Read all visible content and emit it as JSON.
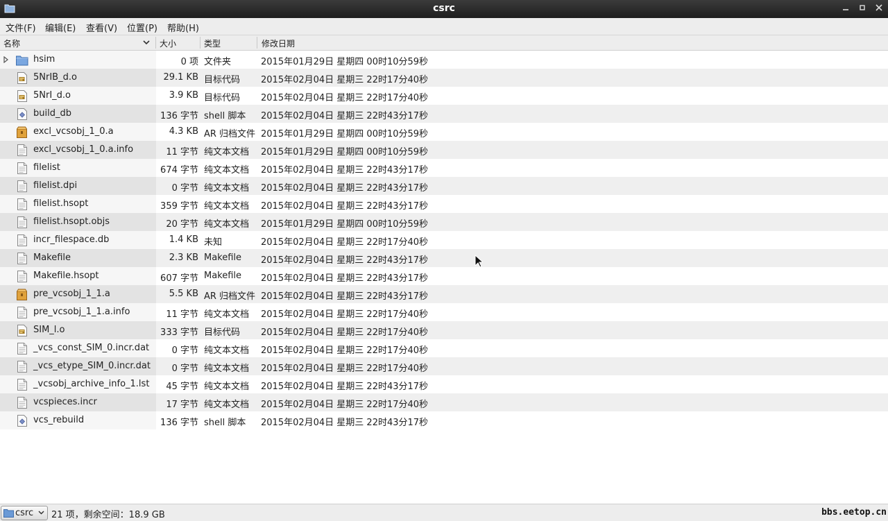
{
  "window": {
    "title": "csrc"
  },
  "menu": [
    "文件(F)",
    "编辑(E)",
    "查看(V)",
    "位置(P)",
    "帮助(H)"
  ],
  "columns": {
    "name": "名称",
    "size": "大小",
    "type": "类型",
    "date": "修改日期"
  },
  "files": [
    {
      "name": "hsim",
      "size": "0 项",
      "type": "文件夹",
      "date": "2015年01月29日 星期四 00时10分59秒",
      "icon": "folder-icon",
      "expandable": true
    },
    {
      "name": "5NrIB_d.o",
      "size": "29.1 KB",
      "type": "目标代码",
      "date": "2015年02月04日 星期三 22时17分40秒",
      "icon": "object-file-icon"
    },
    {
      "name": "5NrI_d.o",
      "size": "3.9 KB",
      "type": "目标代码",
      "date": "2015年02月04日 星期三 22时17分40秒",
      "icon": "object-file-icon"
    },
    {
      "name": "build_db",
      "size": "136 字节",
      "type": "shell 脚本",
      "date": "2015年02月04日 星期三 22时43分17秒",
      "icon": "script-file-icon"
    },
    {
      "name": "excl_vcsobj_1_0.a",
      "size": "4.3 KB",
      "type": "AR 归档文件",
      "date": "2015年01月29日 星期四 00时10分59秒",
      "icon": "archive-file-icon"
    },
    {
      "name": "excl_vcsobj_1_0.a.info",
      "size": "11 字节",
      "type": "纯文本文档",
      "date": "2015年01月29日 星期四 00时10分59秒",
      "icon": "text-file-icon"
    },
    {
      "name": "filelist",
      "size": "674 字节",
      "type": "纯文本文档",
      "date": "2015年02月04日 星期三 22时43分17秒",
      "icon": "text-file-icon"
    },
    {
      "name": "filelist.dpi",
      "size": "0 字节",
      "type": "纯文本文档",
      "date": "2015年02月04日 星期三 22时43分17秒",
      "icon": "text-file-icon"
    },
    {
      "name": "filelist.hsopt",
      "size": "359 字节",
      "type": "纯文本文档",
      "date": "2015年02月04日 星期三 22时43分17秒",
      "icon": "text-file-icon"
    },
    {
      "name": "filelist.hsopt.objs",
      "size": "20 字节",
      "type": "纯文本文档",
      "date": "2015年01月29日 星期四 00时10分59秒",
      "icon": "text-file-icon"
    },
    {
      "name": "incr_filespace.db",
      "size": "1.4 KB",
      "type": "未知",
      "date": "2015年02月04日 星期三 22时17分40秒",
      "icon": "text-file-icon"
    },
    {
      "name": "Makefile",
      "size": "2.3 KB",
      "type": "Makefile",
      "date": "2015年02月04日 星期三 22时43分17秒",
      "icon": "text-file-icon"
    },
    {
      "name": "Makefile.hsopt",
      "size": "607 字节",
      "type": "Makefile",
      "date": "2015年02月04日 星期三 22时43分17秒",
      "icon": "text-file-icon"
    },
    {
      "name": "pre_vcsobj_1_1.a",
      "size": "5.5 KB",
      "type": "AR 归档文件",
      "date": "2015年02月04日 星期三 22时43分17秒",
      "icon": "archive-file-icon"
    },
    {
      "name": "pre_vcsobj_1_1.a.info",
      "size": "11 字节",
      "type": "纯文本文档",
      "date": "2015年02月04日 星期三 22时17分40秒",
      "icon": "text-file-icon"
    },
    {
      "name": "SIM_l.o",
      "size": "333 字节",
      "type": "目标代码",
      "date": "2015年02月04日 星期三 22时17分40秒",
      "icon": "object-file-icon"
    },
    {
      "name": "_vcs_const_SIM_0.incr.dat",
      "size": "0 字节",
      "type": "纯文本文档",
      "date": "2015年02月04日 星期三 22时17分40秒",
      "icon": "text-file-icon"
    },
    {
      "name": "_vcs_etype_SIM_0.incr.dat",
      "size": "0 字节",
      "type": "纯文本文档",
      "date": "2015年02月04日 星期三 22时17分40秒",
      "icon": "text-file-icon"
    },
    {
      "name": "_vcsobj_archive_info_1.lst",
      "size": "45 字节",
      "type": "纯文本文档",
      "date": "2015年02月04日 星期三 22时43分17秒",
      "icon": "text-file-icon"
    },
    {
      "name": "vcspieces.incr",
      "size": "17 字节",
      "type": "纯文本文档",
      "date": "2015年02月04日 星期三 22时17分40秒",
      "icon": "text-file-icon"
    },
    {
      "name": "vcs_rebuild",
      "size": "136 字节",
      "type": "shell 脚本",
      "date": "2015年02月04日 星期三 22时43分17秒",
      "icon": "script-file-icon"
    }
  ],
  "status": {
    "location": "csrc",
    "summary": "21 项，剩余空间：18.9 GB",
    "watermark": "bbs.eetop.cn"
  }
}
